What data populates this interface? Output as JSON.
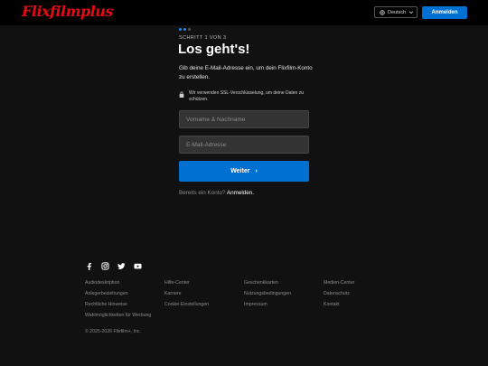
{
  "header": {
    "logo": "Flixfilmplus",
    "language": "Deutsch",
    "login_label": "Anmelden"
  },
  "signup": {
    "step": "SCHRITT 1 VON 3",
    "title": "Los geht's!",
    "description": "Gib deine E-Mail-Adresse ein, um dein Flixfilm-Konto zu erstellen.",
    "ssl_note": "Wir verwenden SSL-Verschlüsselung, um deine Daten zu schützen.",
    "name_placeholder": "Vorname & Nachname",
    "email_placeholder": "E-Mail-Adresse",
    "continue_label": "Weiter",
    "continue_arrow": "›",
    "already_text": "Bereits ein Konto?",
    "already_link": "Anmelden."
  },
  "footer": {
    "links": [
      "Audiodeskription",
      "Hilfe-Center",
      "Geschenkkarten",
      "Medien-Center",
      "Anlegerbeziehungen",
      "Karriere",
      "Nutzungsbedingungen",
      "Datenschutz",
      "Rechtliche Hinweise",
      "Cookie-Einstellungen",
      "Impressum",
      "Kontakt",
      "Wahlmöglichkeiten für Werbung"
    ],
    "copyright": "© 2025-2026 Flixfilm+, Inc.",
    "social_icons": [
      "facebook-icon",
      "instagram-icon",
      "twitter-icon",
      "youtube-icon"
    ]
  },
  "colors": {
    "brand": "#e50914",
    "accent": "#0071d2",
    "background": "#111111"
  }
}
